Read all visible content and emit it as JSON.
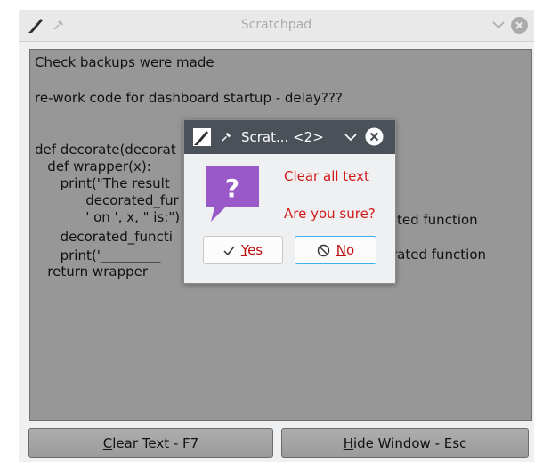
{
  "window": {
    "title": "Scratchpad"
  },
  "editor": {
    "lines": [
      "Check backups were made",
      "re-work code for dashboard startup - delay???",
      "def decorate(decorat",
      "   def wrapper(x):",
      "      print(\"The result",
      "            decorated_fur",
      "            ' on ', x, \" is:\")",
      "      decorated_functi",
      "      print('_________",
      "   return wrapper"
    ],
    "right_fragments": [
      "ted function",
      "rated function"
    ]
  },
  "buttons": {
    "clear_text": "Clear Text - F7",
    "hide_window": "Hide Window - Esc"
  },
  "dialog": {
    "title": "Scrat... <2>",
    "message1": "Clear all text",
    "message2": "Are you sure?",
    "yes_label": "Yes",
    "no_label": "No",
    "yes_icon": "check-icon",
    "no_icon": "cancel-circle-icon"
  },
  "colors": {
    "dialog_titlebar": "#4b5158",
    "message_text": "#d11a1a",
    "focus_border": "#3daee9",
    "question_icon": "#9a59c8"
  }
}
